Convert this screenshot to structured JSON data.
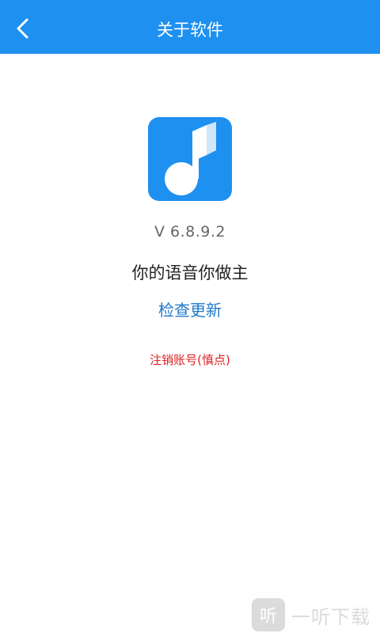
{
  "header": {
    "title": "关于软件",
    "back_icon": "chevron-left-icon",
    "background_color": "#1e90f0"
  },
  "app": {
    "icon": "music-note-icon",
    "icon_color": "#1e90f0",
    "version": "V 6.8.9.2",
    "slogan": "你的语音你做主"
  },
  "actions": {
    "check_update": "检查更新",
    "cancel_account": "注销账号(慎点)"
  },
  "watermark": {
    "logo_char": "听",
    "text": "一听下载"
  }
}
